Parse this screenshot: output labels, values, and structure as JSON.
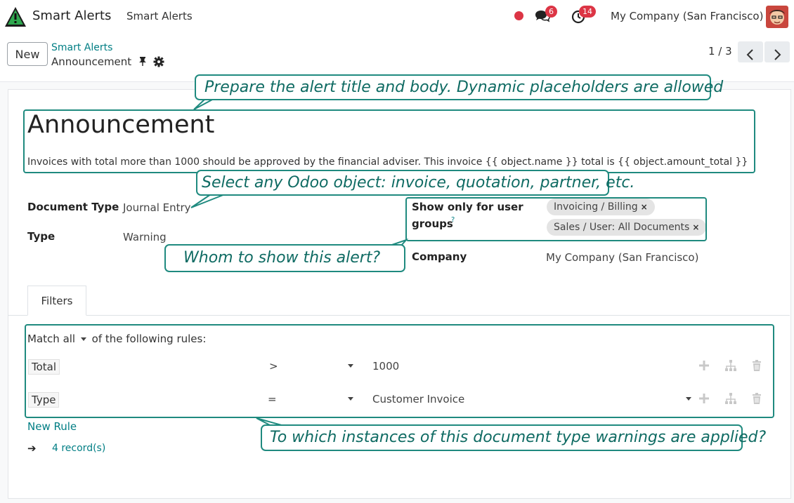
{
  "navbar": {
    "app_name": "Smart Alerts",
    "menu_item": "Smart Alerts",
    "messages_count": "6",
    "activities_count": "14",
    "company": "My Company (San Francisco)"
  },
  "control_panel": {
    "new_label": "New",
    "breadcrumb_parent": "Smart Alerts",
    "breadcrumb_current": "Announcement",
    "pager": "1 / 3"
  },
  "form": {
    "title": "Announcement",
    "body": "Invoices with total more than 1000 should be approved by the financial adviser. This invoice {{ object.name }} total is {{ object.amount_total }}",
    "document_type_label": "Document Type",
    "document_type_value": "Journal Entry",
    "type_label": "Type",
    "type_value": "Warning",
    "groups_label_line1": "Show only for user",
    "groups_label_line2": "groups",
    "groups_help": "?",
    "groups": [
      "Invoicing / Billing",
      "Sales / User: All Documents"
    ],
    "company_label": "Company",
    "company_value": "My Company (San Francisco)"
  },
  "tabs": [
    {
      "label": "Filters"
    }
  ],
  "filters": {
    "match_prefix": "Match",
    "match_mode": "all",
    "match_suffix": "of the following rules:",
    "rules": [
      {
        "field": "Total",
        "operator": ">",
        "value": "1000"
      },
      {
        "field": "Type",
        "operator": "=",
        "value": "Customer Invoice"
      }
    ],
    "new_rule_label": "New Rule",
    "arrow": "➔",
    "records_label": "4 record(s)"
  },
  "callouts": {
    "title_hint": "Prepare the alert title and body. Dynamic placeholders are allowed",
    "object_hint": "Select any Odoo object: invoice, quotation, partner, etc.",
    "groups_hint": "Whom to show this alert?",
    "filters_hint": "To which instances of this document type warnings are applied?"
  },
  "colors": {
    "accent": "#017e84",
    "callout": "#1f8a7f",
    "badge": "#dc3545"
  },
  "icons": [
    "app-logo-icon",
    "recording-dot-icon",
    "chat-icon",
    "clock-icon",
    "avatar",
    "pin-icon",
    "gear-icon",
    "chevron-left-icon",
    "chevron-right-icon",
    "plus-icon",
    "hierarchy-icon",
    "trash-icon",
    "caret-down-icon"
  ]
}
